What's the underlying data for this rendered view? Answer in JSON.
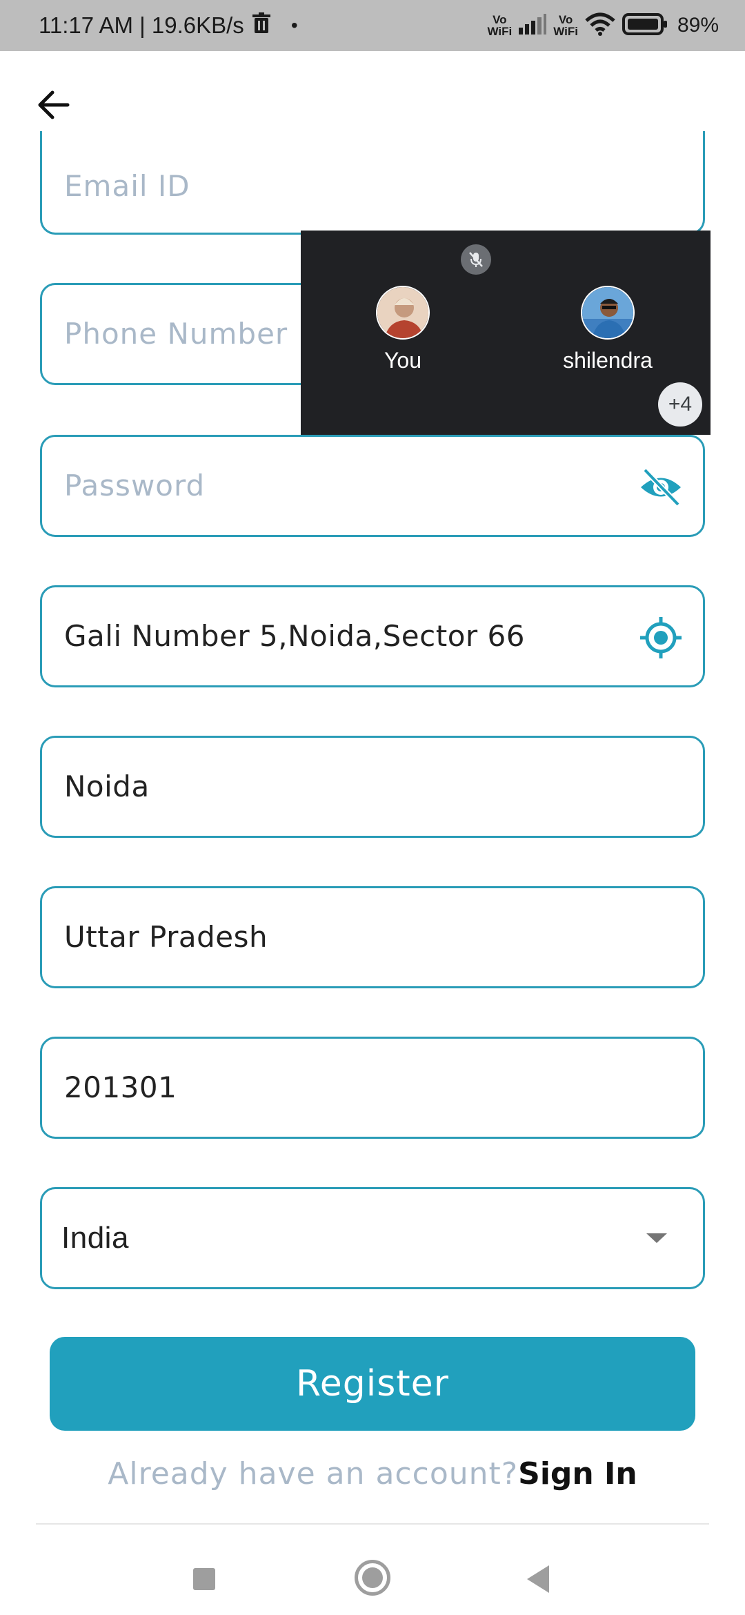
{
  "status_bar": {
    "time_speed": "11:17 AM | 19.6KB/s",
    "vowifi_1_top": "Vo",
    "vowifi_1_bottom": "WiFi",
    "vowifi_2_top": "Vo",
    "vowifi_2_bottom": "WiFi",
    "battery_percent": "89%",
    "icons": [
      "trash-icon",
      "signal-icon",
      "wifi-icon",
      "battery-icon"
    ]
  },
  "form": {
    "email_placeholder": "Email ID",
    "phone_placeholder": "Phone Number",
    "password_placeholder": "Password",
    "address_value": "Gali Number 5,Noida,Sector 66",
    "city_value": "Noida",
    "state_value": "Uttar Pradesh",
    "pincode_value": "201301",
    "country_value": "India"
  },
  "actions": {
    "register_label": "Register",
    "already_account_text": "Already have an account?",
    "sign_in_label": "Sign In"
  },
  "call_overlay": {
    "participants": [
      {
        "name": "You"
      },
      {
        "name": "shilendra"
      }
    ],
    "more_count": "+4"
  },
  "colors": {
    "accent": "#21a0bd",
    "border": "#2a9cb7",
    "placeholder": "#a9b8c8",
    "overlay_bg": "#202124"
  }
}
